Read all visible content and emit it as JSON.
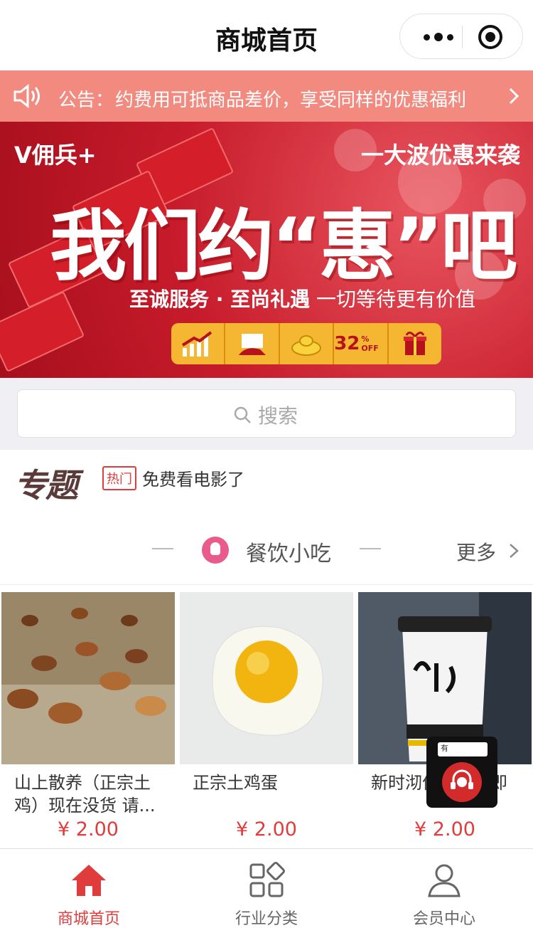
{
  "nav": {
    "title": "商城首页"
  },
  "notice": {
    "label": "公告：",
    "text": "约费用可抵商品差价，享受同样的优惠福利"
  },
  "banner": {
    "brand": "V佣兵+",
    "slogan_top": "一大波优惠来袭",
    "headline": "我们约“惠”吧",
    "sub_bold": "至诚服务 · 至尚礼遇",
    "sub_rest": " 一切等待更有价值",
    "discount": "32",
    "discount_unit": "% OFF"
  },
  "search": {
    "placeholder": "搜索"
  },
  "topic": {
    "logo": "专题",
    "hot": "热门",
    "headline": "免费看电影了"
  },
  "section": {
    "name": "餐饮小吃",
    "more": "更多"
  },
  "products": [
    {
      "name": "山上散养（正宗土鸡）现在没货 请...",
      "price": "¥ 2.00"
    },
    {
      "name": "正宗土鸡蛋",
      "price": "¥ 2.00"
    },
    {
      "name": "新时沏优惠卷）即",
      "price": "¥ 2.00"
    }
  ],
  "service": {
    "bubble": "有"
  },
  "tabbar": [
    {
      "label": "商城首页",
      "active": true
    },
    {
      "label": "行业分类",
      "active": false
    },
    {
      "label": "会员中心",
      "active": false
    }
  ],
  "colors": {
    "accent": "#e03c3c",
    "notice_bg": "#f28a7f",
    "banner_red": "#c71b2b"
  }
}
